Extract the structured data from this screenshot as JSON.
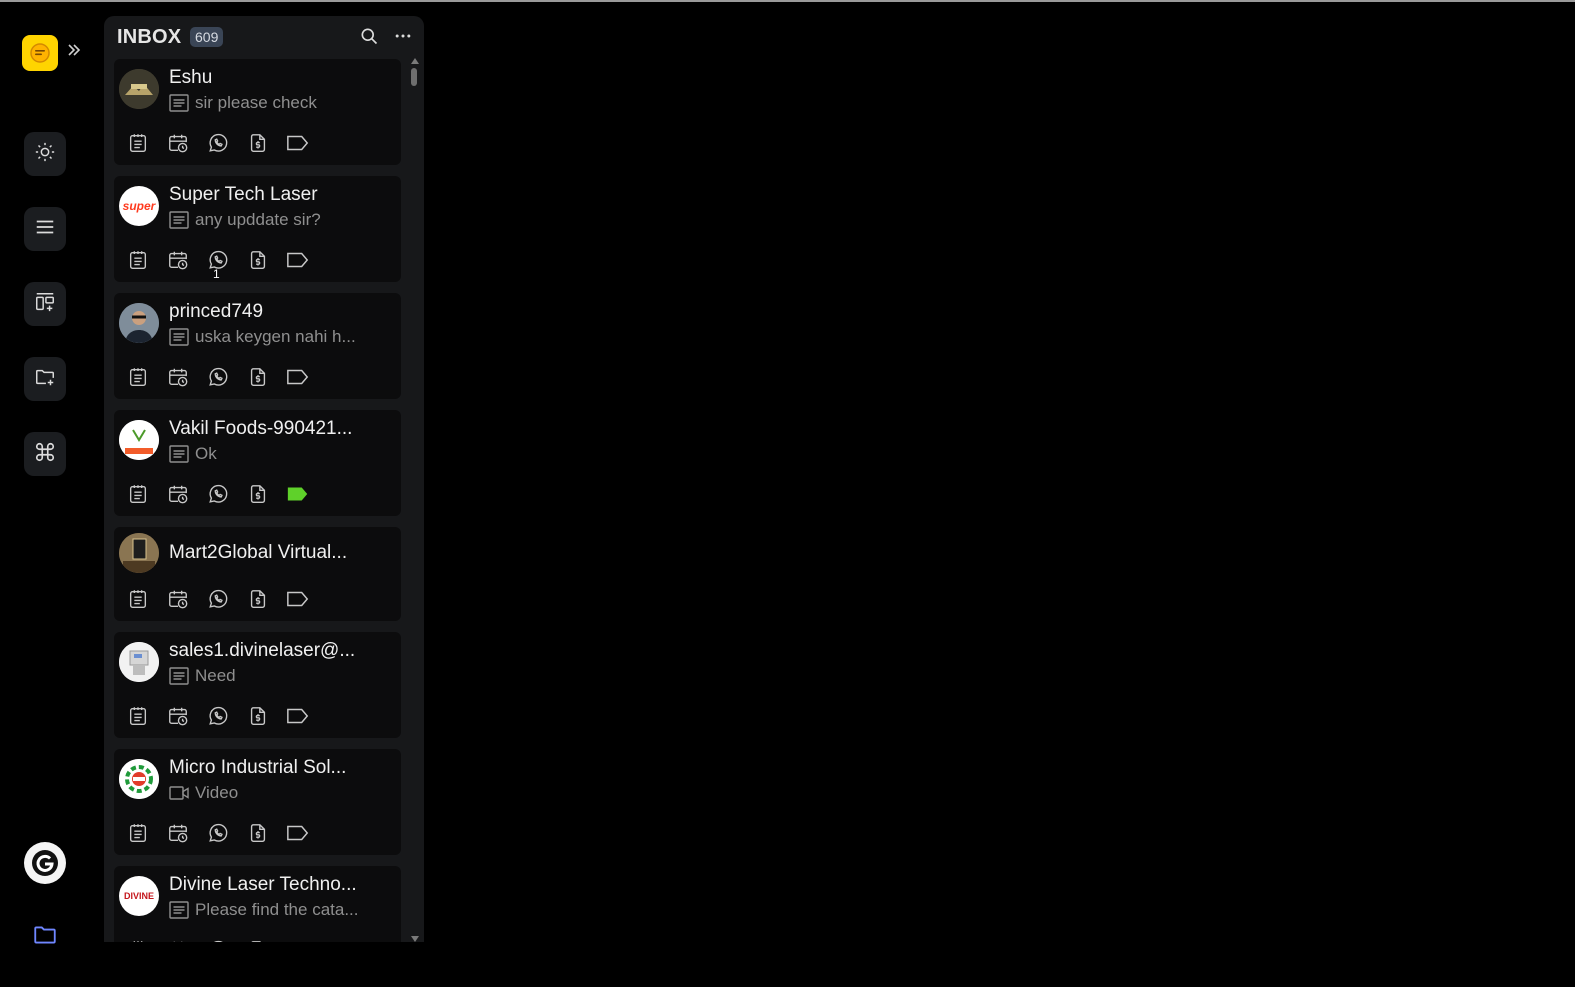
{
  "colors": {
    "background": "#000000",
    "panel": "#17181a",
    "card": "#0c0c0d",
    "accent_yellow": "#ffd400",
    "tag_active": "#5fd12a",
    "folder_blue": "#6f86ff"
  },
  "rail": {
    "logo_icon": "chat-bubble-icon",
    "expand_icon": "double-chevron-right-icon",
    "buttons": [
      {
        "icon": "sun-icon"
      },
      {
        "icon": "menu-lines-icon"
      },
      {
        "icon": "board-add-icon"
      },
      {
        "icon": "folder-add-icon"
      },
      {
        "icon": "command-icon"
      }
    ],
    "brand_icon": "brand-g-logo-icon",
    "folder_icon": "folder-icon"
  },
  "inbox": {
    "title": "INBOX",
    "count": "609",
    "search_icon": "search-icon",
    "more_icon": "ellipsis-icon"
  },
  "conversations": [
    {
      "name": "Eshu",
      "preview": "sir please check",
      "preview_icon": "message-icon",
      "tag_active": false,
      "unread": ""
    },
    {
      "name": "Super Tech Laser",
      "preview": "any upddate sir?",
      "preview_icon": "message-icon",
      "tag_active": false,
      "unread": "1"
    },
    {
      "name": "princed749",
      "preview": "uska keygen nahi h...",
      "preview_icon": "message-icon",
      "tag_active": false,
      "unread": ""
    },
    {
      "name": "Vakil Foods-990421...",
      "preview": "Ok",
      "preview_icon": "message-icon",
      "tag_active": true,
      "unread": ""
    },
    {
      "name": "Mart2Global Virtual...",
      "preview": "",
      "preview_icon": "",
      "tag_active": false,
      "unread": ""
    },
    {
      "name": "sales1.divinelaser@...",
      "preview": "Need",
      "preview_icon": "message-icon",
      "tag_active": false,
      "unread": ""
    },
    {
      "name": "Micro Industrial Sol...",
      "preview": "Video",
      "preview_icon": "video-icon",
      "tag_active": false,
      "unread": ""
    },
    {
      "name": "Divine Laser Techno...",
      "preview": "Please find the cata...",
      "preview_icon": "message-icon",
      "tag_active": false,
      "unread": ""
    }
  ],
  "avatar_text": {
    "super_tech": "super",
    "divine": "DIVINE"
  }
}
